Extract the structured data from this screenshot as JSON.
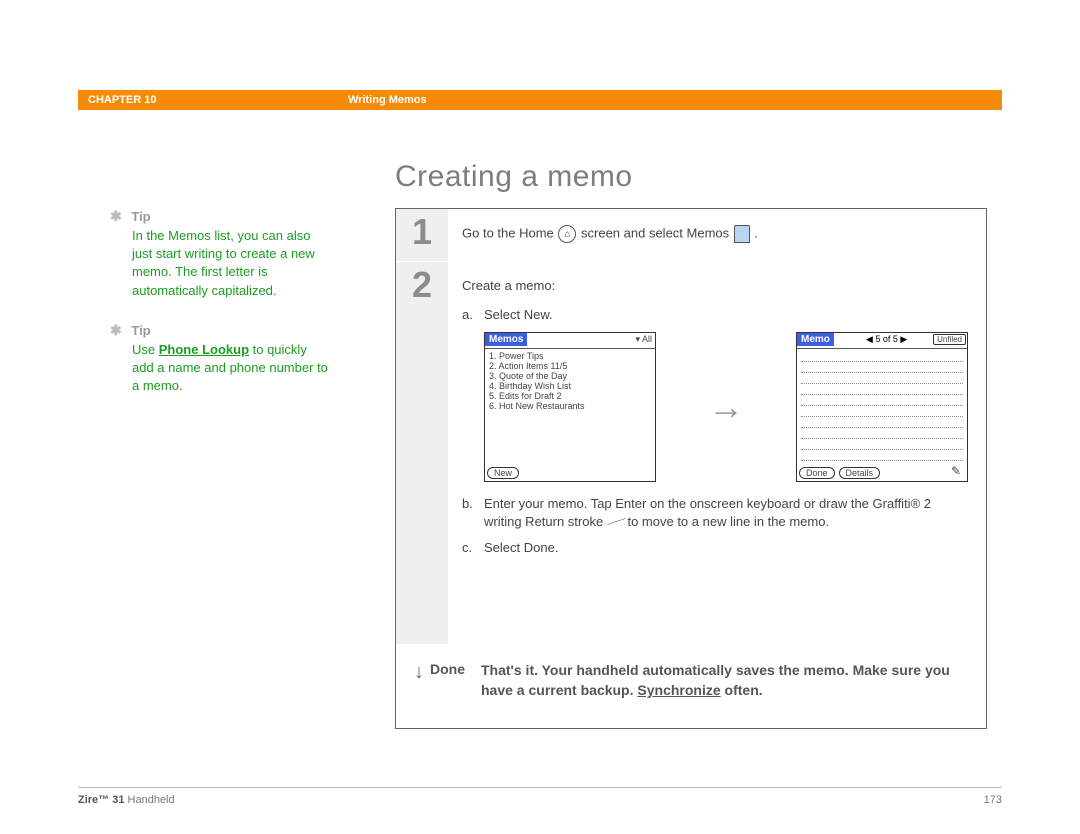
{
  "header": {
    "chapter": "CHAPTER 10",
    "section": "Writing Memos"
  },
  "title": "Creating a memo",
  "tips": [
    {
      "label": "Tip",
      "text": "In the Memos list, you can also just start writing to create a new memo. The first letter is automatically capitalized."
    },
    {
      "label": "Tip",
      "link_text": "Phone Lookup",
      "before_link": "Use ",
      "after_link": " to quickly add a name and phone number to a memo."
    }
  ],
  "steps": {
    "s1": {
      "num": "1",
      "before_home": "Go to the Home ",
      "after_home": " screen and select Memos ",
      "after_memos": "."
    },
    "s2": {
      "num": "2",
      "intro": "Create a memo:",
      "a_letter": "a.",
      "a_text": "Select New.",
      "b_letter": "b.",
      "b_text": "Enter your memo. Tap Enter on the onscreen keyboard or draw the Graffiti® 2 writing Return stroke ",
      "b_text2": " to move to a new line in the memo.",
      "c_letter": "c.",
      "c_text": "Select Done."
    }
  },
  "screens": {
    "left": {
      "title": "Memos",
      "dropdown": "▾ All",
      "items": [
        "1. Power Tips",
        "2. Action Items 11/5",
        "3. Quote of the Day",
        "4. Birthday Wish List",
        "5. Edits for Draft 2",
        "6. Hot New Restaurants"
      ],
      "new_btn": "New"
    },
    "right": {
      "title": "Memo",
      "pager": "◀  5 of 5  ▶",
      "unfiled": "Unfiled",
      "done_btn": "Done",
      "details_btn": "Details"
    }
  },
  "done": {
    "label": "Done",
    "text_before": "That's it. Your handheld automatically saves the memo. Make sure you have a current backup. ",
    "sync": "Synchronize",
    "text_after": " often."
  },
  "footer": {
    "product_bold": "Zire™ 31",
    "product_rest": " Handheld",
    "page": "173"
  }
}
